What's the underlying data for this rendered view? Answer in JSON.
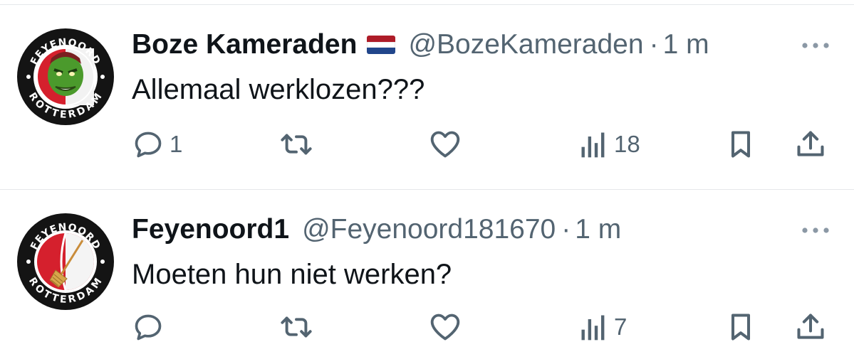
{
  "tweets": [
    {
      "display_name": "Boze Kameraden",
      "has_flag": true,
      "flag_colors": [
        "#ae1c28",
        "#ffffff",
        "#21468b"
      ],
      "handle": "@BozeKameraden",
      "separator": "·",
      "time": "1 m",
      "text": "Allemaal werklozen???",
      "avatar": {
        "ring_text_top": "FEYENOORD",
        "ring_text_bottom": "ROTTERDAM",
        "image": "green-hulk-face"
      },
      "actions": {
        "reply_count": "1",
        "retweet_count": "",
        "like_count": "",
        "views_count": "18"
      }
    },
    {
      "display_name": "Feyenoord1",
      "has_flag": false,
      "handle": "@Feyenoord181670",
      "separator": "·",
      "time": "1 m",
      "text": "Moeten hun niet werken?",
      "avatar": {
        "ring_text_top": "FEYENOORD",
        "ring_text_bottom": "ROTTERDAM",
        "image": "red-white-shield-broom"
      },
      "actions": {
        "reply_count": "",
        "retweet_count": "",
        "like_count": "",
        "views_count": "7"
      }
    }
  ],
  "icons": [
    "more-icon",
    "reply-icon",
    "retweet-icon",
    "like-icon",
    "views-icon",
    "bookmark-icon",
    "share-icon"
  ],
  "colors": {
    "text": "#0f1419",
    "secondary": "#536471",
    "divider": "#e5e7ea",
    "avatar_red": "#d5202d"
  }
}
